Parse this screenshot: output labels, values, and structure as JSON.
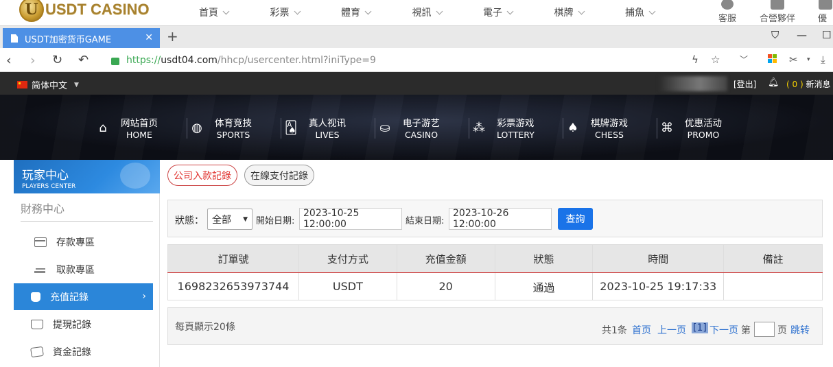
{
  "site": {
    "logo_text": "USDT CASINO",
    "logo_letter": "U",
    "nav": [
      {
        "label": "首頁"
      },
      {
        "label": "彩票"
      },
      {
        "label": "體育"
      },
      {
        "label": "視訊"
      },
      {
        "label": "電子"
      },
      {
        "label": "棋牌"
      },
      {
        "label": "捕魚"
      }
    ],
    "right": [
      {
        "label": "客服"
      },
      {
        "label": "合營夥伴"
      },
      {
        "label": "優惠"
      }
    ]
  },
  "browser": {
    "tab_title": "USDT加密货币GAME",
    "url_protocol": "https://",
    "url_domain": "usdt04.com",
    "url_path": "/hhcp/usercenter.html?iniType=9"
  },
  "topbar": {
    "language": "简体中文",
    "logout": "[登出]",
    "msg_count": "( 0 )",
    "msg_label": "新消息"
  },
  "banner_nav": [
    {
      "zh": "网站首页",
      "en": "HOME",
      "icon": "home-icon"
    },
    {
      "zh": "体育竞技",
      "en": "SPORTS",
      "icon": "ball-icon"
    },
    {
      "zh": "真人视讯",
      "en": "LIVES",
      "icon": "cards-icon"
    },
    {
      "zh": "电子游艺",
      "en": "CASINO",
      "icon": "slot-icon"
    },
    {
      "zh": "彩票游戏",
      "en": "LOTTERY",
      "icon": "lottery-balls-icon"
    },
    {
      "zh": "棋牌游戏",
      "en": "CHESS",
      "icon": "spade-icon"
    },
    {
      "zh": "优惠活动",
      "en": "PROMO",
      "icon": "gift-icon"
    }
  ],
  "sidebar": {
    "title_zh": "玩家中心",
    "title_en": "PLAYERS CENTER",
    "section": "財務中心",
    "items": [
      {
        "label": "存款專區"
      },
      {
        "label": "取款專區"
      },
      {
        "label": "充值記錄"
      },
      {
        "label": "提現記錄"
      },
      {
        "label": "資金記錄"
      }
    ]
  },
  "main": {
    "tab_company": "公司入款記錄",
    "tab_online": "在線支付記錄",
    "filter": {
      "status_label": "狀態：",
      "status_value": "全部",
      "start_label": "開始日期:",
      "start_value": "2023-10-25 12:00:00",
      "end_label": "結束日期:",
      "end_value": "2023-10-26 12:00:00",
      "query": "查詢"
    },
    "table": {
      "headers": [
        "訂單號",
        "支付方式",
        "充值金額",
        "狀態",
        "時間",
        "備註"
      ],
      "rows": [
        [
          "1698232653973744",
          "USDT",
          "20",
          "通過",
          "2023-10-25 19:17:33",
          ""
        ]
      ]
    },
    "pager": {
      "per_page": "每頁顯示20條",
      "total": "共1条",
      "first": "首页",
      "prev": "上一页",
      "current": "[1]",
      "next": "下一页",
      "goto_prefix": "第",
      "goto_suffix": "页",
      "jump": "跳转"
    }
  }
}
